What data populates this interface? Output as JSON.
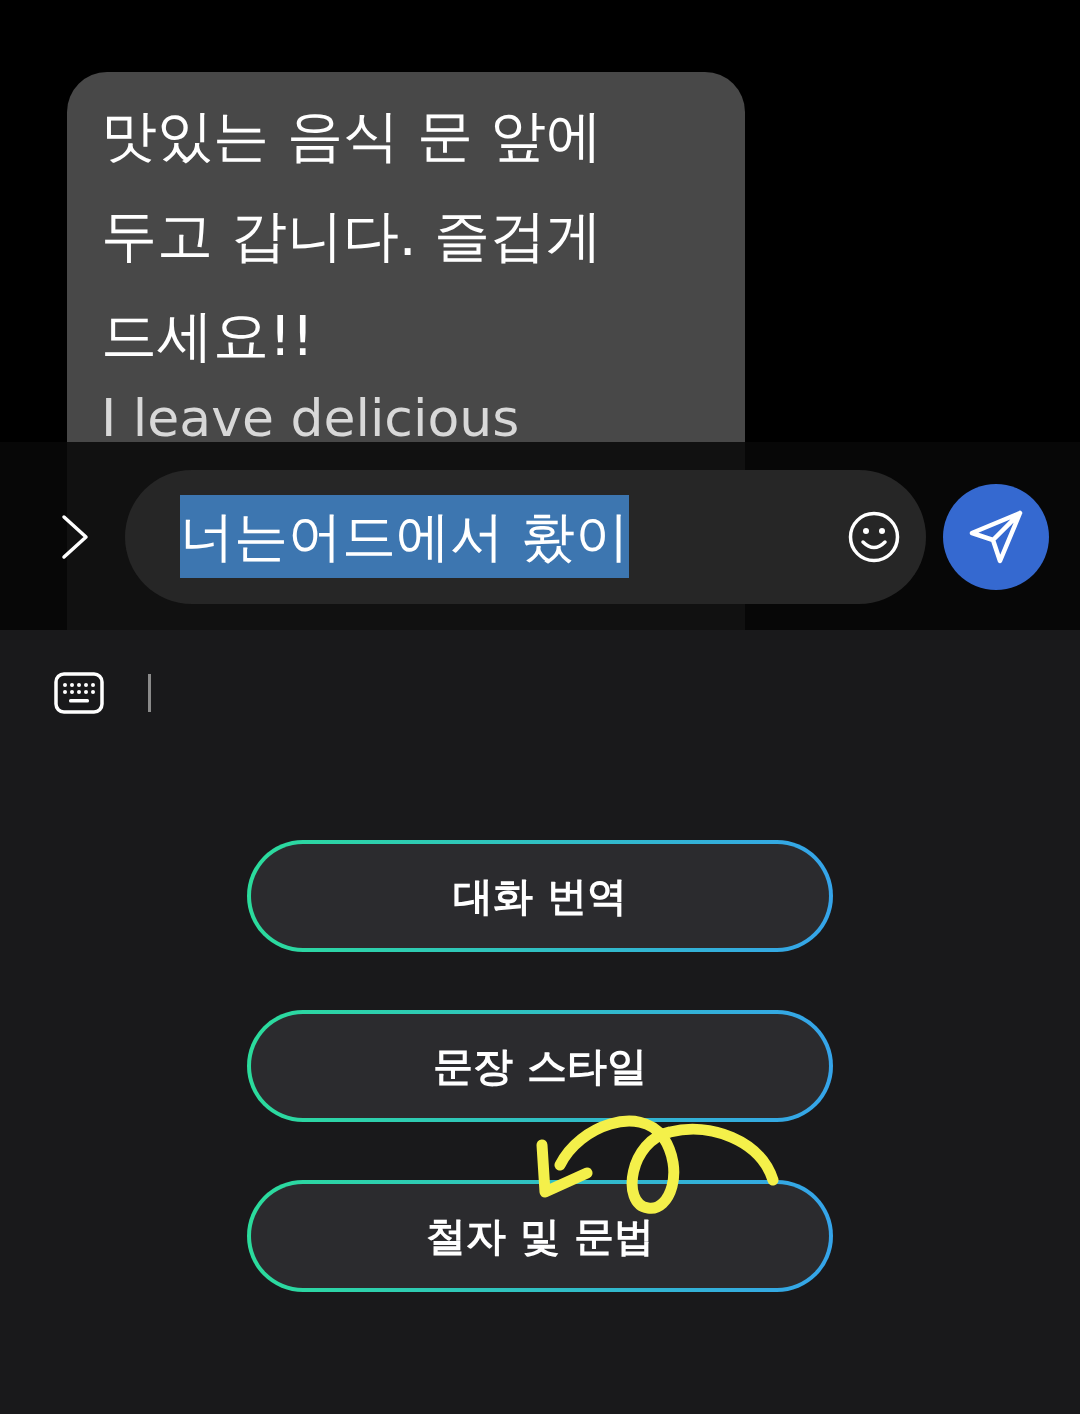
{
  "chat": {
    "message": {
      "text": "맛있는 음식 문 앞에 두고 갑니다. 즐겁게 드세요!!",
      "translation": "I leave delicious"
    }
  },
  "composer": {
    "value": "너는어드에서 홨이",
    "selected": true
  },
  "panel": {
    "buttons": [
      {
        "label": "대화 번역"
      },
      {
        "label": "문장 스타일"
      },
      {
        "label": "철자 및 문법"
      }
    ]
  }
}
